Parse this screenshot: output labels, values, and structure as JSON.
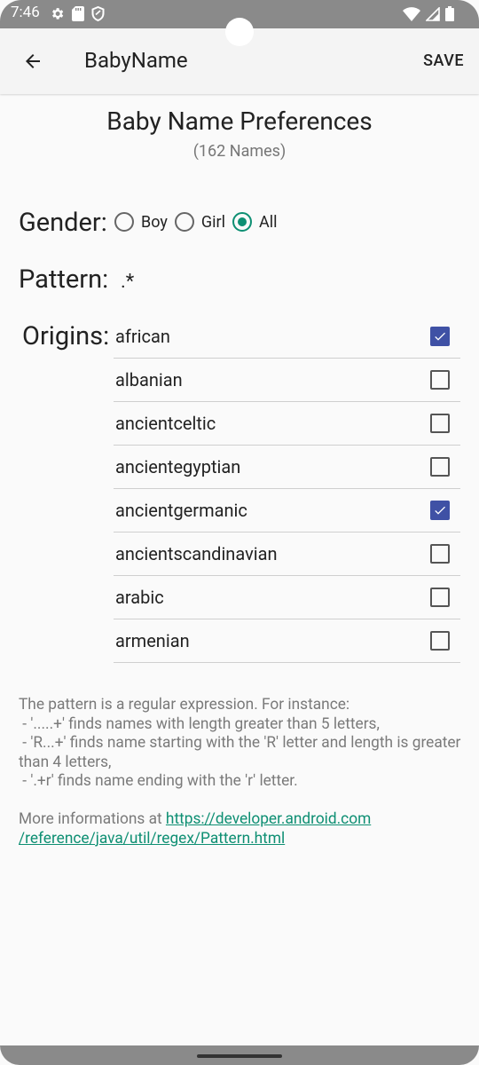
{
  "status_bar": {
    "time": "7:46",
    "left_icons": [
      "gear-icon",
      "sd-card-icon",
      "shield-icon"
    ],
    "right_icons": [
      "wifi-icon",
      "signal-icon",
      "battery-icon"
    ]
  },
  "app_bar": {
    "title": "BabyName",
    "save_label": "SAVE"
  },
  "header": {
    "title": "Baby Name Preferences",
    "count": "(162 Names)"
  },
  "gender": {
    "label": "Gender:",
    "options": [
      {
        "label": "Boy",
        "checked": false
      },
      {
        "label": "Girl",
        "checked": false
      },
      {
        "label": "All",
        "checked": true
      }
    ]
  },
  "pattern": {
    "label": "Pattern:",
    "value": ".*"
  },
  "origins": {
    "label": "Origins:",
    "items": [
      {
        "name": "african",
        "checked": true
      },
      {
        "name": "albanian",
        "checked": false
      },
      {
        "name": "ancientceltic",
        "checked": false
      },
      {
        "name": "ancientegyptian",
        "checked": false
      },
      {
        "name": "ancientgermanic",
        "checked": true
      },
      {
        "name": "ancientscandinavian",
        "checked": false
      },
      {
        "name": "arabic",
        "checked": false
      },
      {
        "name": "armenian",
        "checked": false
      }
    ]
  },
  "help": {
    "lines": [
      "The pattern is a regular expression. For instance:",
      " - '.....+' finds names with length greater than 5 letters,",
      " - 'R...+' finds name starting with the 'R' letter and length is greater than 4 letters,",
      " - '.+r' finds name ending with the 'r' letter."
    ],
    "more_prefix": "More informations at ",
    "more_link": "https://developer.android.com/reference/java/util/regex/Pattern.html",
    "more_link_line1": "https://developer.android.com",
    "more_link_line2": "/reference/java/util/regex/Pattern.html"
  },
  "colors": {
    "accent": "#0e8f73",
    "checkbox": "#3f51a5"
  }
}
